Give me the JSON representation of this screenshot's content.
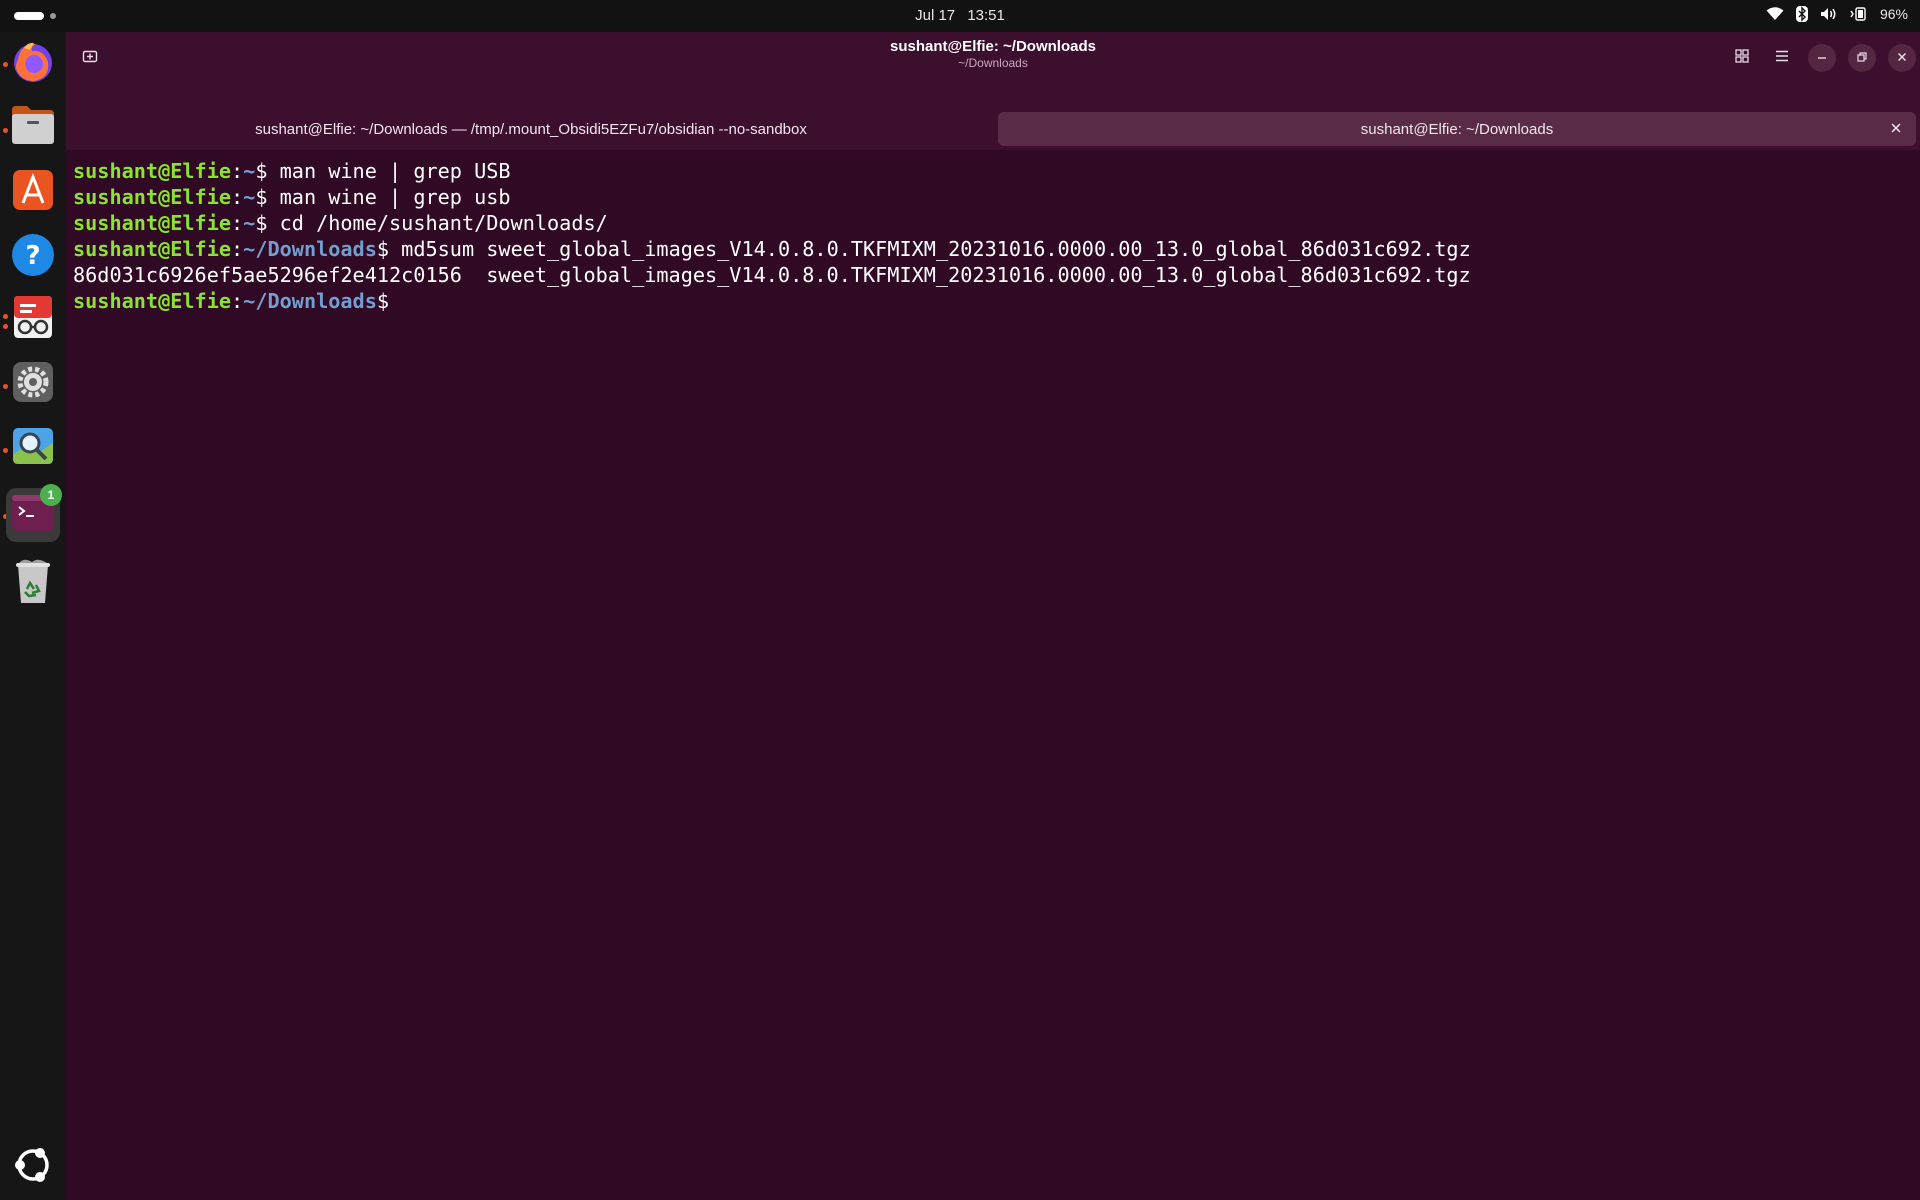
{
  "topbar": {
    "date": "Jul 17",
    "time": "13:51",
    "battery": "96%",
    "icons": [
      "wifi-icon",
      "bluetooth-icon",
      "volume-icon",
      "battery-icon"
    ]
  },
  "dock": {
    "apps": [
      "firefox-icon",
      "files-icon",
      "app-center-icon",
      "help-icon",
      "document-viewer-icon",
      "settings-icon",
      "image-viewer-icon",
      "terminal-icon",
      "trash-icon",
      "show-apps-icon"
    ],
    "terminal_badge": "1"
  },
  "window": {
    "title": "sushant@Elfie: ~/Downloads",
    "subtitle": "~/Downloads"
  },
  "tabs": [
    {
      "label": "sushant@Elfie: ~/Downloads — /tmp/.mount_Obsidi5EZFu7/obsidian --no-sandbox"
    },
    {
      "label": "sushant@Elfie: ~/Downloads"
    }
  ],
  "terminal": {
    "lines": [
      {
        "user": "sushant@Elfie",
        "sep": ":",
        "path": "~",
        "prompt": "$",
        "text": " man wine | grep USB"
      },
      {
        "user": "sushant@Elfie",
        "sep": ":",
        "path": "~",
        "prompt": "$",
        "text": " man wine | grep usb"
      },
      {
        "user": "sushant@Elfie",
        "sep": ":",
        "path": "~",
        "prompt": "$",
        "text": " cd /home/sushant/Downloads/"
      },
      {
        "user": "sushant@Elfie",
        "sep": ":",
        "path": "~/Downloads",
        "prompt": "$",
        "text": " md5sum sweet_global_images_V14.0.8.0.TKFMIXM_20231016.0000.00_13.0_global_86d031c692.tgz"
      },
      {
        "output": "86d031c6926ef5ae5296ef2e412c0156  sweet_global_images_V14.0.8.0.TKFMIXM_20231016.0000.00_13.0_global_86d031c692.tgz"
      },
      {
        "user": "sushant@Elfie",
        "sep": ":",
        "path": "~/Downloads",
        "prompt": "$",
        "text": ""
      }
    ]
  },
  "colors": {
    "terminal_bg": "#300a24",
    "prompt_user": "#8ae234",
    "prompt_path": "#729fcf",
    "ubuntu_orange": "#e95420"
  }
}
